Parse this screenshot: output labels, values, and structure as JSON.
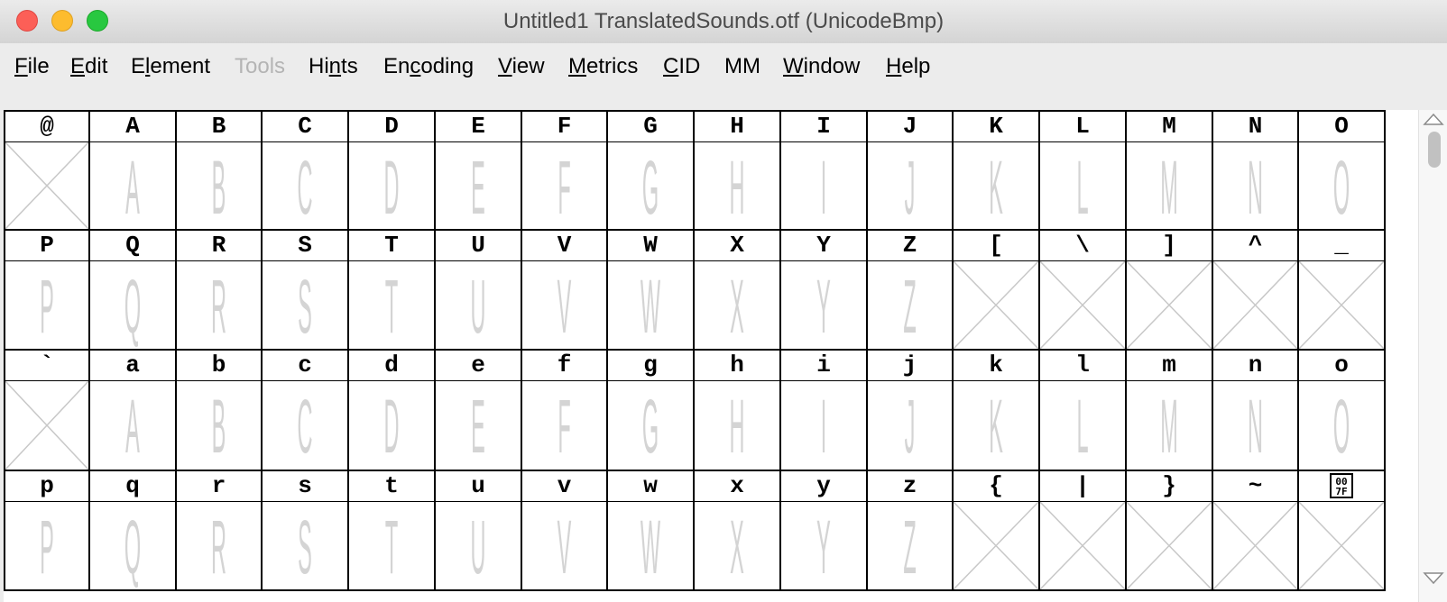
{
  "window": {
    "title": "Untitled1  TranslatedSounds.otf (UnicodeBmp)",
    "traffic_lights": {
      "close": "#fc5f57",
      "minimize": "#fdbc2e",
      "maximize": "#28c840"
    }
  },
  "menubar": {
    "items": [
      {
        "label": "File",
        "enabled": true
      },
      {
        "label": "Edit",
        "enabled": true
      },
      {
        "label": "Element",
        "enabled": true
      },
      {
        "label": "Tools",
        "enabled": false
      },
      {
        "label": "Hints",
        "enabled": true
      },
      {
        "label": "Encoding",
        "enabled": true
      },
      {
        "label": "View",
        "enabled": true
      },
      {
        "label": "Metrics",
        "enabled": true
      },
      {
        "label": "CID",
        "enabled": true
      },
      {
        "label": "MM",
        "enabled": true
      },
      {
        "label": "Window",
        "enabled": true
      },
      {
        "label": "Help",
        "enabled": true
      }
    ]
  },
  "font_view": {
    "rows": [
      [
        {
          "label": "@",
          "glyph": null
        },
        {
          "label": "A",
          "glyph": "A"
        },
        {
          "label": "B",
          "glyph": "B"
        },
        {
          "label": "C",
          "glyph": "C"
        },
        {
          "label": "D",
          "glyph": "D"
        },
        {
          "label": "E",
          "glyph": "E"
        },
        {
          "label": "F",
          "glyph": "F"
        },
        {
          "label": "G",
          "glyph": "G"
        },
        {
          "label": "H",
          "glyph": "H"
        },
        {
          "label": "I",
          "glyph": "I"
        },
        {
          "label": "J",
          "glyph": "J"
        },
        {
          "label": "K",
          "glyph": "K"
        },
        {
          "label": "L",
          "glyph": "L"
        },
        {
          "label": "M",
          "glyph": "M"
        },
        {
          "label": "N",
          "glyph": "N"
        },
        {
          "label": "O",
          "glyph": "O"
        }
      ],
      [
        {
          "label": "P",
          "glyph": "P"
        },
        {
          "label": "Q",
          "glyph": "Q"
        },
        {
          "label": "R",
          "glyph": "R"
        },
        {
          "label": "S",
          "glyph": "S"
        },
        {
          "label": "T",
          "glyph": "T"
        },
        {
          "label": "U",
          "glyph": "U"
        },
        {
          "label": "V",
          "glyph": "V"
        },
        {
          "label": "W",
          "glyph": "W"
        },
        {
          "label": "X",
          "glyph": "X"
        },
        {
          "label": "Y",
          "glyph": "Y"
        },
        {
          "label": "Z",
          "glyph": "Z"
        },
        {
          "label": "[",
          "glyph": null
        },
        {
          "label": "\\",
          "glyph": null
        },
        {
          "label": "]",
          "glyph": null
        },
        {
          "label": "^",
          "glyph": null
        },
        {
          "label": "_",
          "glyph": null
        }
      ],
      [
        {
          "label": "`",
          "glyph": null
        },
        {
          "label": "a",
          "glyph": "A"
        },
        {
          "label": "b",
          "glyph": "B"
        },
        {
          "label": "c",
          "glyph": "C"
        },
        {
          "label": "d",
          "glyph": "D"
        },
        {
          "label": "e",
          "glyph": "E"
        },
        {
          "label": "f",
          "glyph": "F"
        },
        {
          "label": "g",
          "glyph": "G"
        },
        {
          "label": "h",
          "glyph": "H"
        },
        {
          "label": "i",
          "glyph": "I"
        },
        {
          "label": "j",
          "glyph": "J"
        },
        {
          "label": "k",
          "glyph": "K"
        },
        {
          "label": "l",
          "glyph": "L"
        },
        {
          "label": "m",
          "glyph": "M"
        },
        {
          "label": "n",
          "glyph": "N"
        },
        {
          "label": "o",
          "glyph": "O"
        }
      ],
      [
        {
          "label": "p",
          "glyph": "P"
        },
        {
          "label": "q",
          "glyph": "Q"
        },
        {
          "label": "r",
          "glyph": "R"
        },
        {
          "label": "s",
          "glyph": "S"
        },
        {
          "label": "t",
          "glyph": "T"
        },
        {
          "label": "u",
          "glyph": "U"
        },
        {
          "label": "v",
          "glyph": "V"
        },
        {
          "label": "w",
          "glyph": "W"
        },
        {
          "label": "x",
          "glyph": "X"
        },
        {
          "label": "y",
          "glyph": "Y"
        },
        {
          "label": "z",
          "glyph": "Z"
        },
        {
          "label": "{",
          "glyph": null
        },
        {
          "label": "|",
          "glyph": null
        },
        {
          "label": "}",
          "glyph": null
        },
        {
          "label": "~",
          "glyph": null
        },
        {
          "label": "",
          "badge": [
            "00",
            "7F"
          ],
          "glyph": null
        }
      ]
    ],
    "colors": {
      "grid_line": "#000000",
      "glyph_outline": "#d4d4d4",
      "empty_cross": "#c8c8c8"
    }
  },
  "icons": {
    "scroll_up": "triangle-up-icon",
    "scroll_down": "triangle-down-icon",
    "empty_glyph": "cross-box-icon"
  }
}
